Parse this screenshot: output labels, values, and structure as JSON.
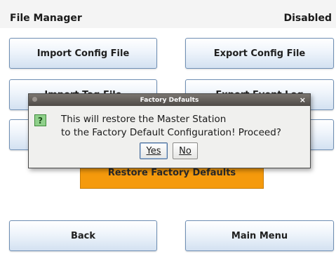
{
  "header": {
    "title": "File Manager",
    "status": "Disabled"
  },
  "buttons": {
    "import_config": "Import Config File",
    "export_config": "Export Config File",
    "import_tag": "Import Tag File",
    "export_event": "Export Event Log",
    "restore_defaults": "Restore Factory Defaults",
    "back": "Back",
    "main_menu": "Main Menu"
  },
  "dialog": {
    "title": "Factory Defaults",
    "icon": "question-icon",
    "icon_glyph": "?",
    "close_glyph": "×",
    "message_line1": "This will restore the Master Station",
    "message_line2": "to the Factory Default Configuration! Proceed?",
    "yes_label": "Yes",
    "no_label": "No"
  },
  "colors": {
    "button_border": "#6f8fb4",
    "restore_button": "#f59a0c",
    "dialog_titlebar": "#4f4b47"
  }
}
